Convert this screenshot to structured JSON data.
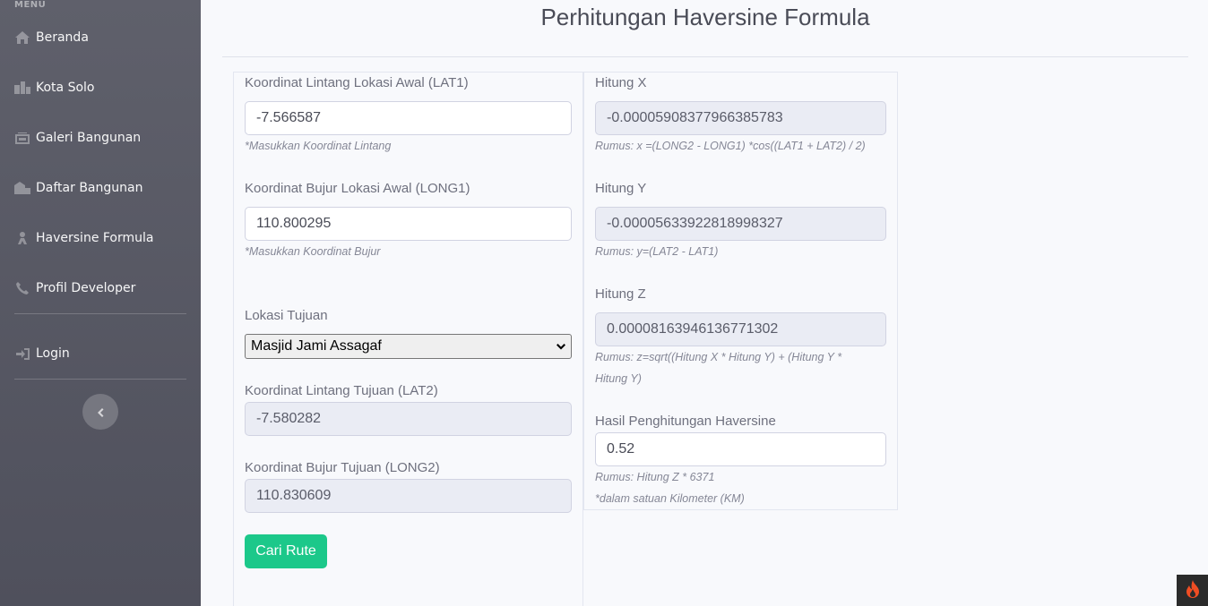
{
  "sidebar": {
    "heading": "MENU",
    "items": [
      {
        "label": "Beranda",
        "icon": "home-icon"
      },
      {
        "label": "Kota Solo",
        "icon": "city-icon"
      },
      {
        "label": "Galeri Bangunan",
        "icon": "gallery-icon"
      },
      {
        "label": "Daftar Bangunan",
        "icon": "buildings-icon"
      },
      {
        "label": "Haversine Formula",
        "icon": "route-icon"
      },
      {
        "label": "Profil Developer",
        "icon": "phone-icon"
      }
    ],
    "login_label": "Login",
    "toggle_icon": "chevron-left-icon"
  },
  "page": {
    "title": "Perhitungan Haversine Formula"
  },
  "form_left": {
    "lat1_label": "Koordinat Lintang Lokasi Awal (LAT1)",
    "lat1_value": "-7.566587",
    "lat1_help": "*Masukkan Koordinat Lintang",
    "long1_label": "Koordinat Bujur Lokasi Awal (LONG1)",
    "long1_value": "110.800295",
    "long1_help": "*Masukkan Koordinat Bujur",
    "dest_label": "Lokasi Tujuan",
    "dest_selected": "Masjid Jami Assagaf",
    "lat2_label": "Koordinat Lintang Tujuan (LAT2)",
    "lat2_value": "-7.580282",
    "long2_label": "Koordinat Bujur Tujuan (LONG2)",
    "long2_value": "110.830609",
    "submit_label": "Cari Rute"
  },
  "form_right": {
    "x_label": "Hitung X",
    "x_value": "-0.00005908377966385783",
    "x_help": "Rumus: x =(LONG2 - LONG1) *cos((LAT1 + LAT2) / 2)",
    "y_label": "Hitung Y",
    "y_value": "-0.00005633922818998327",
    "y_help": "Rumus: y=(LAT2 - LAT1)",
    "z_label": "Hitung Z",
    "z_value": "0.00008163946136771302",
    "z_help_1": "Rumus: z=sqrt((Hitung X * Hitung Y) + (Hitung Y *",
    "z_help_2": "Hitung Y)",
    "result_label": "Hasil Penghitungan Haversine",
    "result_value": "0.52",
    "result_help_1": "Rumus: Hitung Z * 6371",
    "result_help_2": "*dalam satuan Kilometer (KM)"
  },
  "colors": {
    "sidebar_top": "#5f606b",
    "sidebar_bottom": "#4f505c",
    "accent_button": "#1cc88a",
    "readonly_bg": "#eaecf4"
  }
}
